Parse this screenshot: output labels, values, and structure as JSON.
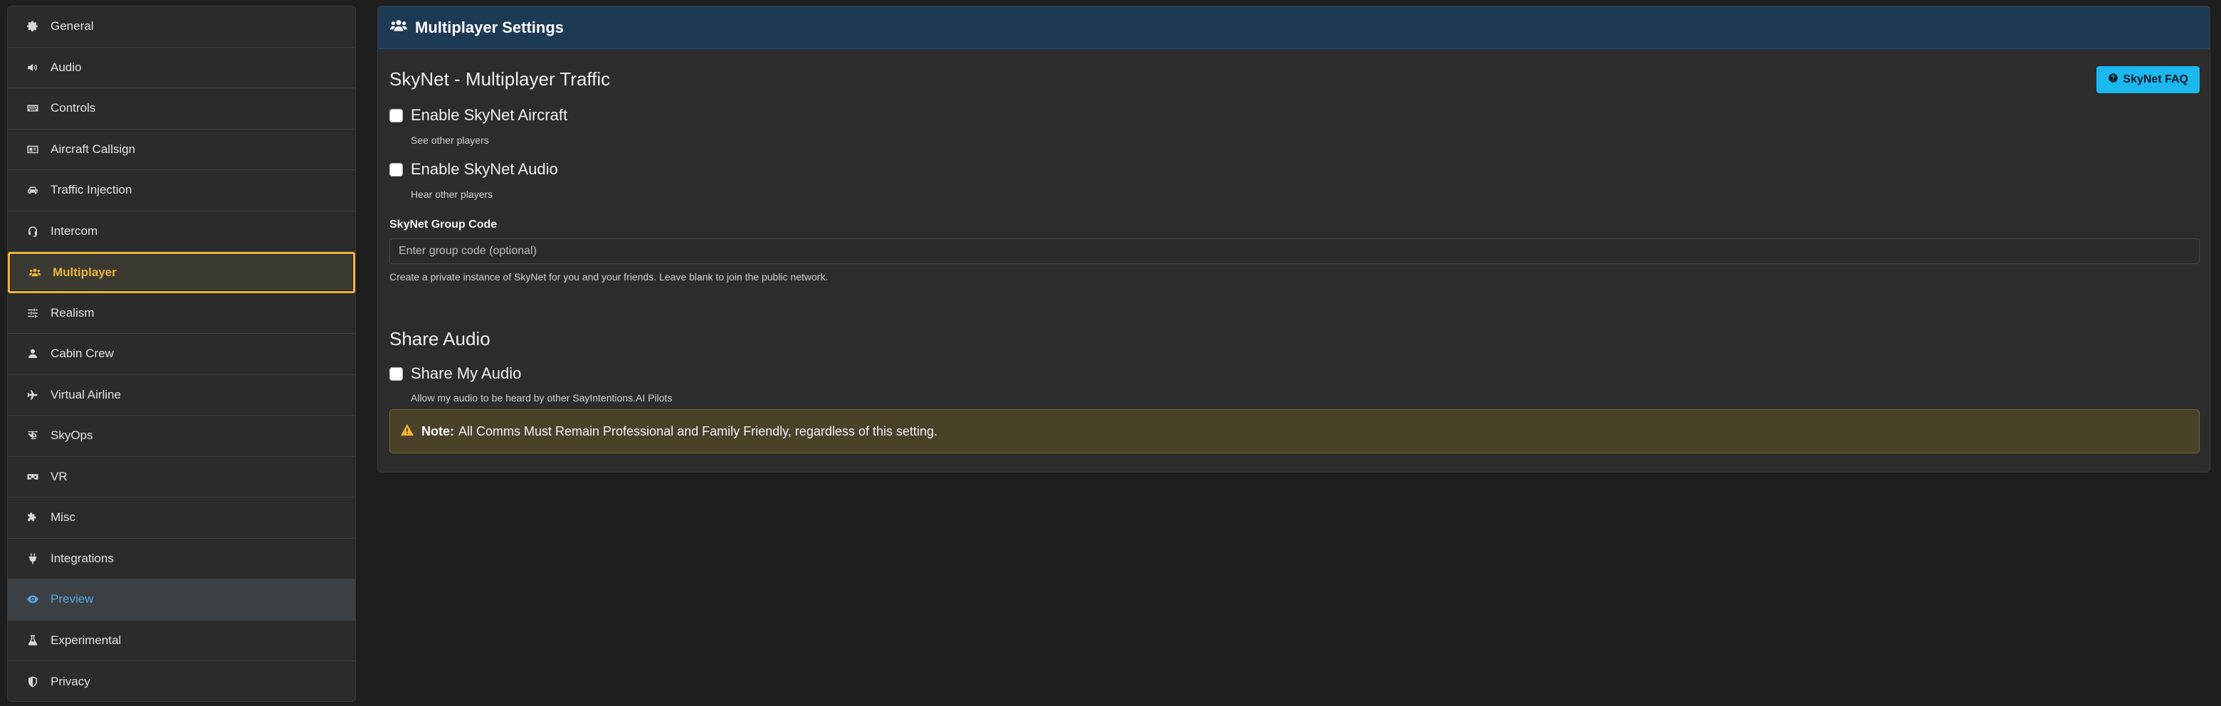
{
  "sidebar": {
    "items": [
      {
        "label": "General",
        "icon": "gear-icon"
      },
      {
        "label": "Audio",
        "icon": "volume-icon"
      },
      {
        "label": "Controls",
        "icon": "keyboard-icon"
      },
      {
        "label": "Aircraft Callsign",
        "icon": "id-card-icon"
      },
      {
        "label": "Traffic Injection",
        "icon": "car-icon"
      },
      {
        "label": "Intercom",
        "icon": "headset-icon"
      },
      {
        "label": "Multiplayer",
        "icon": "users-icon",
        "state": "active"
      },
      {
        "label": "Realism",
        "icon": "sliders-icon"
      },
      {
        "label": "Cabin Crew",
        "icon": "user-icon"
      },
      {
        "label": "Virtual Airline",
        "icon": "plane-icon"
      },
      {
        "label": "SkyOps",
        "icon": "helicopter-icon"
      },
      {
        "label": "VR",
        "icon": "vr-headset-icon"
      },
      {
        "label": "Misc",
        "icon": "puzzle-icon"
      },
      {
        "label": "Integrations",
        "icon": "plug-icon"
      },
      {
        "label": "Preview",
        "icon": "eye-icon",
        "state": "hover"
      },
      {
        "label": "Experimental",
        "icon": "flask-icon"
      },
      {
        "label": "Privacy",
        "icon": "shield-icon"
      }
    ]
  },
  "panel": {
    "title": "Multiplayer Settings",
    "skynet": {
      "heading": "SkyNet - Multiplayer Traffic",
      "faq_label": "SkyNet FAQ",
      "aircraft_label": "Enable SkyNet Aircraft",
      "aircraft_help": "See other players",
      "audio_label": "Enable SkyNet Audio",
      "audio_help": "Hear other players",
      "group_code_label": "SkyNet Group Code",
      "group_code_value": "",
      "group_code_placeholder": "Enter group code (optional)",
      "group_code_help": "Create a private instance of SkyNet for you and your friends. Leave blank to join the public network."
    },
    "share_audio": {
      "heading": "Share Audio",
      "share_label": "Share My Audio",
      "share_help": "Allow my audio to be heard by other SayIntentions.AI Pilots",
      "note_strong": "Note:",
      "note_text": "All Comms Must Remain Professional and Family Friendly, regardless of this setting."
    }
  },
  "colors": {
    "accent_active": "#f0b43c",
    "accent_hover": "#5aa5e0",
    "header_bg": "#1d3a55",
    "faq_button": "#1ab8ee",
    "note_bg": "#4a4129",
    "warning_icon": "#f0b43c"
  }
}
